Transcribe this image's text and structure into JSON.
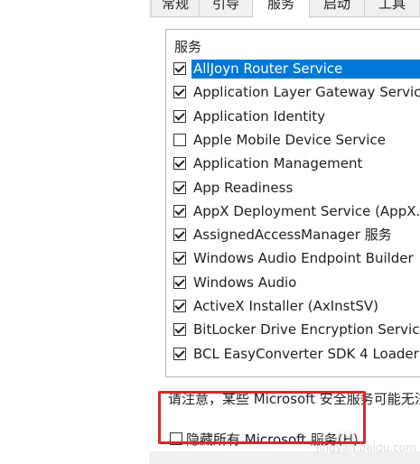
{
  "tabs": [
    "常规",
    "引导",
    "服务",
    "启动",
    "工具"
  ],
  "active_tab": 2,
  "services": {
    "header": "服务",
    "items": [
      {
        "label": "AllJoyn Router Service",
        "checked": true,
        "selected": true
      },
      {
        "label": "Application Layer Gateway Service",
        "checked": true
      },
      {
        "label": "Application Identity",
        "checked": true
      },
      {
        "label": "Apple Mobile Device Service",
        "checked": false
      },
      {
        "label": "Application Management",
        "checked": true
      },
      {
        "label": "App Readiness",
        "checked": true
      },
      {
        "label": "AppX Deployment Service (AppX...",
        "checked": true
      },
      {
        "label": "AssignedAccessManager 服务",
        "checked": true
      },
      {
        "label": "Windows Audio Endpoint Builder",
        "checked": true
      },
      {
        "label": "Windows Audio",
        "checked": true
      },
      {
        "label": "ActiveX Installer (AxInstSV)",
        "checked": true
      },
      {
        "label": "BitLocker Drive Encryption Service",
        "checked": true
      },
      {
        "label": "BCL EasyConverter SDK 4 Loader",
        "checked": true
      }
    ]
  },
  "notice": "请注意，某些 Microsoft 安全服务可能无法",
  "hide_ms": {
    "label": "隐藏所有 Microsoft 服务(H)",
    "checked": false
  },
  "watermark": "Bai 经验\njingyan.baidu.com",
  "colors": {
    "selection": "#0078d7",
    "highlight": "#d9262c"
  }
}
